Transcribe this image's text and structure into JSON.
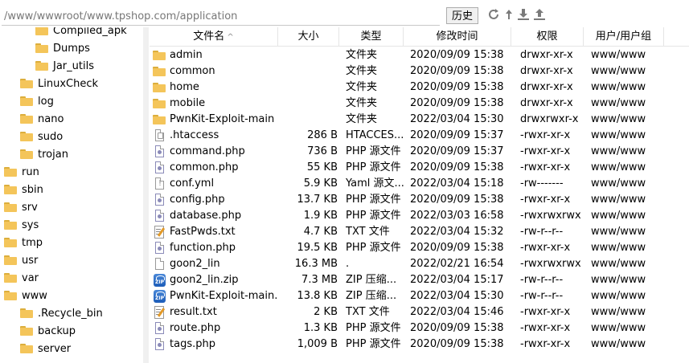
{
  "address": {
    "path": "/www/wwwroot/www.tpshop.com/application",
    "history_label": "历史"
  },
  "toolbar_icons": [
    "refresh-icon",
    "up-icon",
    "download-icon",
    "upload-icon"
  ],
  "tree": [
    {
      "label": "Compiled_apk",
      "indent": 2
    },
    {
      "label": "Dumps",
      "indent": 2
    },
    {
      "label": "Jar_utils",
      "indent": 2
    },
    {
      "label": "LinuxCheck",
      "indent": 1
    },
    {
      "label": "log",
      "indent": 1
    },
    {
      "label": "nano",
      "indent": 1
    },
    {
      "label": "sudo",
      "indent": 1
    },
    {
      "label": "trojan",
      "indent": 1
    },
    {
      "label": "run",
      "indent": 0
    },
    {
      "label": "sbin",
      "indent": 0
    },
    {
      "label": "srv",
      "indent": 0
    },
    {
      "label": "sys",
      "indent": 0
    },
    {
      "label": "tmp",
      "indent": 0
    },
    {
      "label": "usr",
      "indent": 0
    },
    {
      "label": "var",
      "indent": 0
    },
    {
      "label": "www",
      "indent": 0
    },
    {
      "label": ".Recycle_bin",
      "indent": 1
    },
    {
      "label": "backup",
      "indent": 1
    },
    {
      "label": "server",
      "indent": 1
    }
  ],
  "columns": {
    "name": "文件名",
    "size": "大小",
    "type": "类型",
    "modified": "修改时间",
    "perm": "权限",
    "owner": "用户/用户组"
  },
  "files": [
    {
      "name": "admin",
      "size": "",
      "type": "文件夹",
      "modified": "2020/09/09 15:38",
      "perm": "drwxr-xr-x",
      "owner": "www/www",
      "icon": "folder"
    },
    {
      "name": "common",
      "size": "",
      "type": "文件夹",
      "modified": "2020/09/09 15:38",
      "perm": "drwxr-xr-x",
      "owner": "www/www",
      "icon": "folder"
    },
    {
      "name": "home",
      "size": "",
      "type": "文件夹",
      "modified": "2020/09/09 15:38",
      "perm": "drwxr-xr-x",
      "owner": "www/www",
      "icon": "folder"
    },
    {
      "name": "mobile",
      "size": "",
      "type": "文件夹",
      "modified": "2020/09/09 15:38",
      "perm": "drwxr-xr-x",
      "owner": "www/www",
      "icon": "folder"
    },
    {
      "name": "PwnKit-Exploit-main",
      "size": "",
      "type": "文件夹",
      "modified": "2022/03/04 15:30",
      "perm": "drwxrwxr-x",
      "owner": "www/www",
      "icon": "folder"
    },
    {
      "name": ".htaccess",
      "size": "286 B",
      "type": "HTACCES...",
      "modified": "2020/09/09 15:37",
      "perm": "-rwxr-xr-x",
      "owner": "www/www",
      "icon": "htc"
    },
    {
      "name": "command.php",
      "size": "736 B",
      "type": "PHP 源文件",
      "modified": "2020/09/09 15:37",
      "perm": "-rwxr-xr-x",
      "owner": "www/www",
      "icon": "php"
    },
    {
      "name": "common.php",
      "size": "55 KB",
      "type": "PHP 源文件",
      "modified": "2020/09/09 15:38",
      "perm": "-rwxr-xr-x",
      "owner": "www/www",
      "icon": "php"
    },
    {
      "name": "conf.yml",
      "size": "5.9 KB",
      "type": "Yaml 源文...",
      "modified": "2022/03/04 15:18",
      "perm": "-rw-------",
      "owner": "www/www",
      "icon": "yml"
    },
    {
      "name": "config.php",
      "size": "13.7 KB",
      "type": "PHP 源文件",
      "modified": "2020/09/09 15:38",
      "perm": "-rwxr-xr-x",
      "owner": "www/www",
      "icon": "php"
    },
    {
      "name": "database.php",
      "size": "1.9 KB",
      "type": "PHP 源文件",
      "modified": "2022/03/03 16:58",
      "perm": "-rwxrwxrwx",
      "owner": "www/www",
      "icon": "php"
    },
    {
      "name": "FastPwds.txt",
      "size": "4.7 KB",
      "type": "TXT 文件",
      "modified": "2022/03/04 15:32",
      "perm": "-rw-r--r--",
      "owner": "www/www",
      "icon": "txtpen"
    },
    {
      "name": "function.php",
      "size": "19.5 KB",
      "type": "PHP 源文件",
      "modified": "2020/09/09 15:38",
      "perm": "-rwxr-xr-x",
      "owner": "www/www",
      "icon": "php"
    },
    {
      "name": "goon2_lin",
      "size": "16.3 MB",
      "type": ".",
      "modified": "2022/02/21 16:54",
      "perm": "-rwxrwxrwx",
      "owner": "www/www",
      "icon": "blank"
    },
    {
      "name": "goon2_lin.zip",
      "size": "7.3 MB",
      "type": "ZIP 压缩...",
      "modified": "2022/03/04 15:17",
      "perm": "-rw-r--r--",
      "owner": "www/www",
      "icon": "zip"
    },
    {
      "name": "PwnKit-Exploit-main...",
      "size": "13.8 KB",
      "type": "ZIP 压缩...",
      "modified": "2022/03/04 15:30",
      "perm": "-rw-r--r--",
      "owner": "www/www",
      "icon": "zip"
    },
    {
      "name": "result.txt",
      "size": "2 KB",
      "type": "TXT 文件",
      "modified": "2022/03/04 15:46",
      "perm": "-rwxr-xr-x",
      "owner": "www/www",
      "icon": "txtpen"
    },
    {
      "name": "route.php",
      "size": "1.3 KB",
      "type": "PHP 源文件",
      "modified": "2020/09/09 15:38",
      "perm": "-rwxr-xr-x",
      "owner": "www/www",
      "icon": "php"
    },
    {
      "name": "tags.php",
      "size": "1,009 B",
      "type": "PHP 源文件",
      "modified": "2020/09/09 15:38",
      "perm": "-rwxr-xr-x",
      "owner": "www/www",
      "icon": "php"
    }
  ]
}
